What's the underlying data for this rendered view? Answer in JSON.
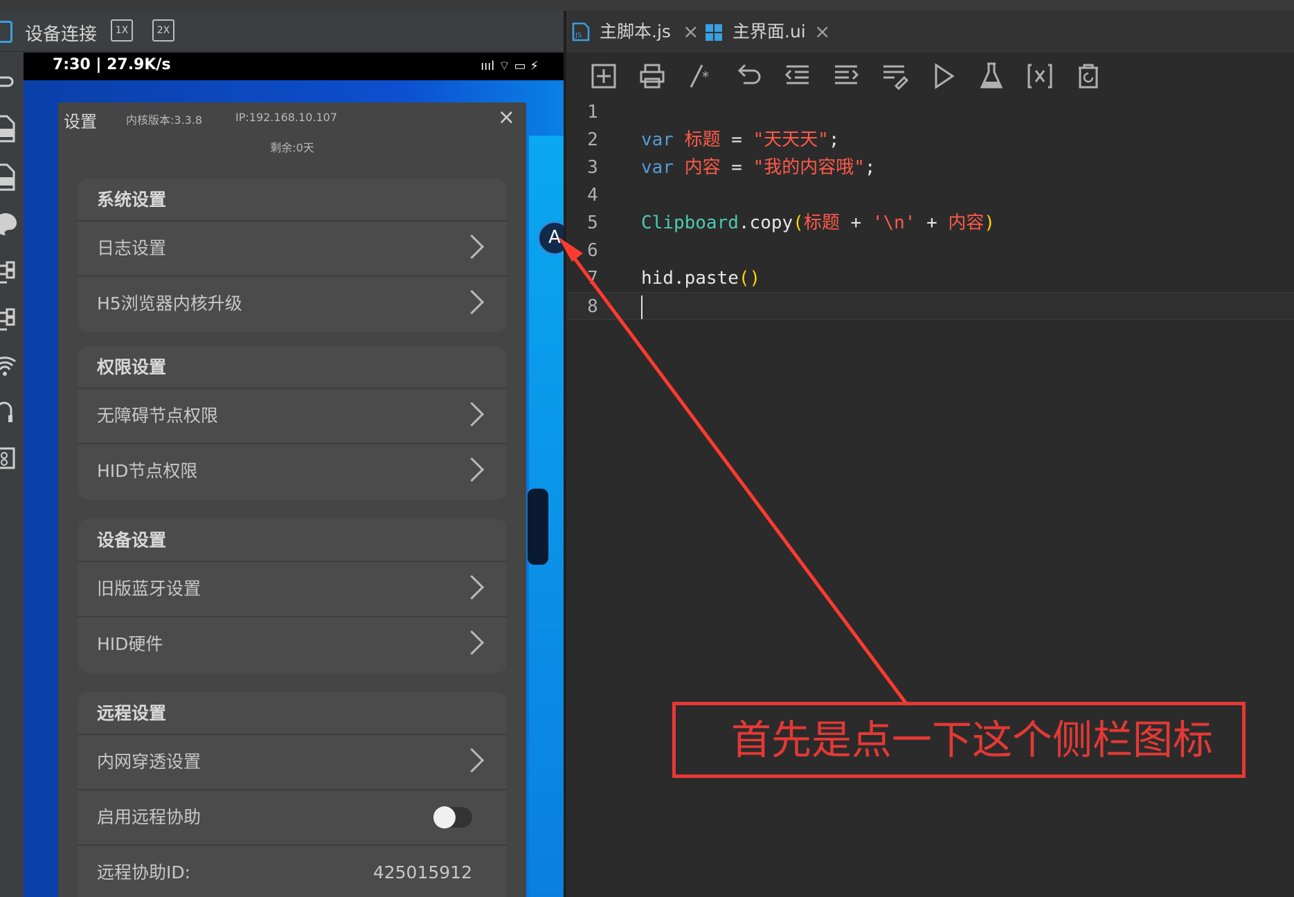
{
  "device_panel": {
    "title": "设备连接",
    "zoom_buttons": [
      "1X",
      "2X"
    ]
  },
  "side_toolbar": {
    "icons": [
      "link-icon",
      "apk-file-icon",
      "xml-file-icon",
      "palette-icon",
      "tree-icon",
      "tree-icon",
      "wifi-icon",
      "headset-icon",
      "image-icon"
    ]
  },
  "phone": {
    "status_left": "7:30 | 27.9K/s",
    "status_right": "ıııl  ⌔  ▭ ⚡",
    "float_ball": "A"
  },
  "settings": {
    "title": "设置",
    "kernel_version": "内核版本:3.3.8",
    "ip": "IP:192.168.10.107",
    "remaining": "剩余:0天",
    "close": "×",
    "groups": [
      {
        "header": "系统设置",
        "rows": [
          {
            "label": "日志设置"
          },
          {
            "label": "H5浏览器内核升级"
          }
        ]
      },
      {
        "header": "权限设置",
        "rows": [
          {
            "label": "无障碍节点权限"
          },
          {
            "label": "HID节点权限"
          }
        ]
      },
      {
        "header": "设备设置",
        "rows": [
          {
            "label": "旧版蓝牙设置"
          },
          {
            "label": "HID硬件"
          }
        ]
      },
      {
        "header": "远程设置",
        "rows": [
          {
            "label": "内网穿透设置"
          },
          {
            "label": "启用远程协助",
            "toggle_on": false
          },
          {
            "label": "远程协助ID:",
            "value": "425015912"
          }
        ]
      }
    ]
  },
  "editor": {
    "tabs": [
      {
        "label": "主脚本.js",
        "active": true
      },
      {
        "label": "主界面.ui",
        "active": false
      }
    ],
    "toolbar_icons": [
      "new-file-icon",
      "print-icon",
      "comment-icon",
      "undo-icon",
      "outdent-icon",
      "indent-icon",
      "format-icon",
      "run-icon",
      "test-icon",
      "variable-icon",
      "delete-icon"
    ],
    "lines": {
      "l1": {
        "n": "1"
      },
      "l2": {
        "n": "2",
        "kw": "var",
        "name": "标题",
        "eq": " = ",
        "val": "\"天天天\"",
        "end": ";"
      },
      "l3": {
        "n": "3",
        "kw": "var",
        "name": "内容",
        "eq": " = ",
        "val": "\"我的内容哦\"",
        "end": ";"
      },
      "l4": {
        "n": "4"
      },
      "l5": {
        "n": "5",
        "cls": "Clipboard",
        "method": ".copy",
        "open": "(",
        "a": "标题",
        "plus1": " + ",
        "s": "'\\n'",
        "plus2": " + ",
        "b": "内容",
        "close": ")"
      },
      "l6": {
        "n": "6"
      },
      "l7": {
        "n": "7",
        "call": "hid.paste",
        "parens": "()"
      },
      "l8": {
        "n": "8"
      }
    }
  },
  "annotation": {
    "text": "首先是点一下这个侧栏图标",
    "color": "#e53935"
  }
}
